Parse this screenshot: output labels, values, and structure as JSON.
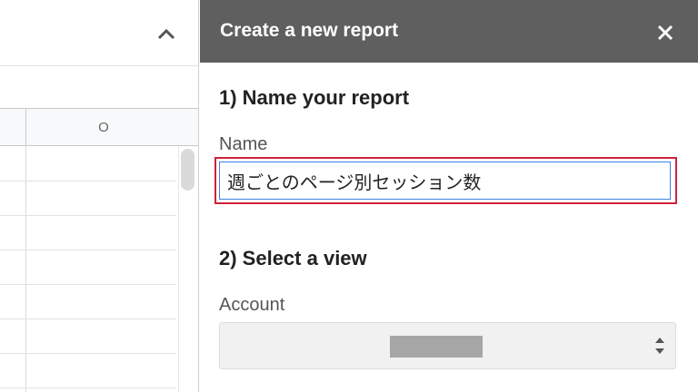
{
  "sheet": {
    "column_header": "O"
  },
  "panel": {
    "title": "Create a new report",
    "section1_title": "1) Name your report",
    "name_label": "Name",
    "name_value": "週ごとのページ別セッション数",
    "section2_title": "2) Select a view",
    "account_label": "Account",
    "account_value": ""
  },
  "icons": {
    "collapse": "chevron-up-icon",
    "close": "close-icon",
    "select": "up-down-arrows-icon"
  },
  "colors": {
    "header_bg": "#5f5f5f",
    "highlight_border": "#d0213a",
    "focus_border": "#3b82e6"
  }
}
